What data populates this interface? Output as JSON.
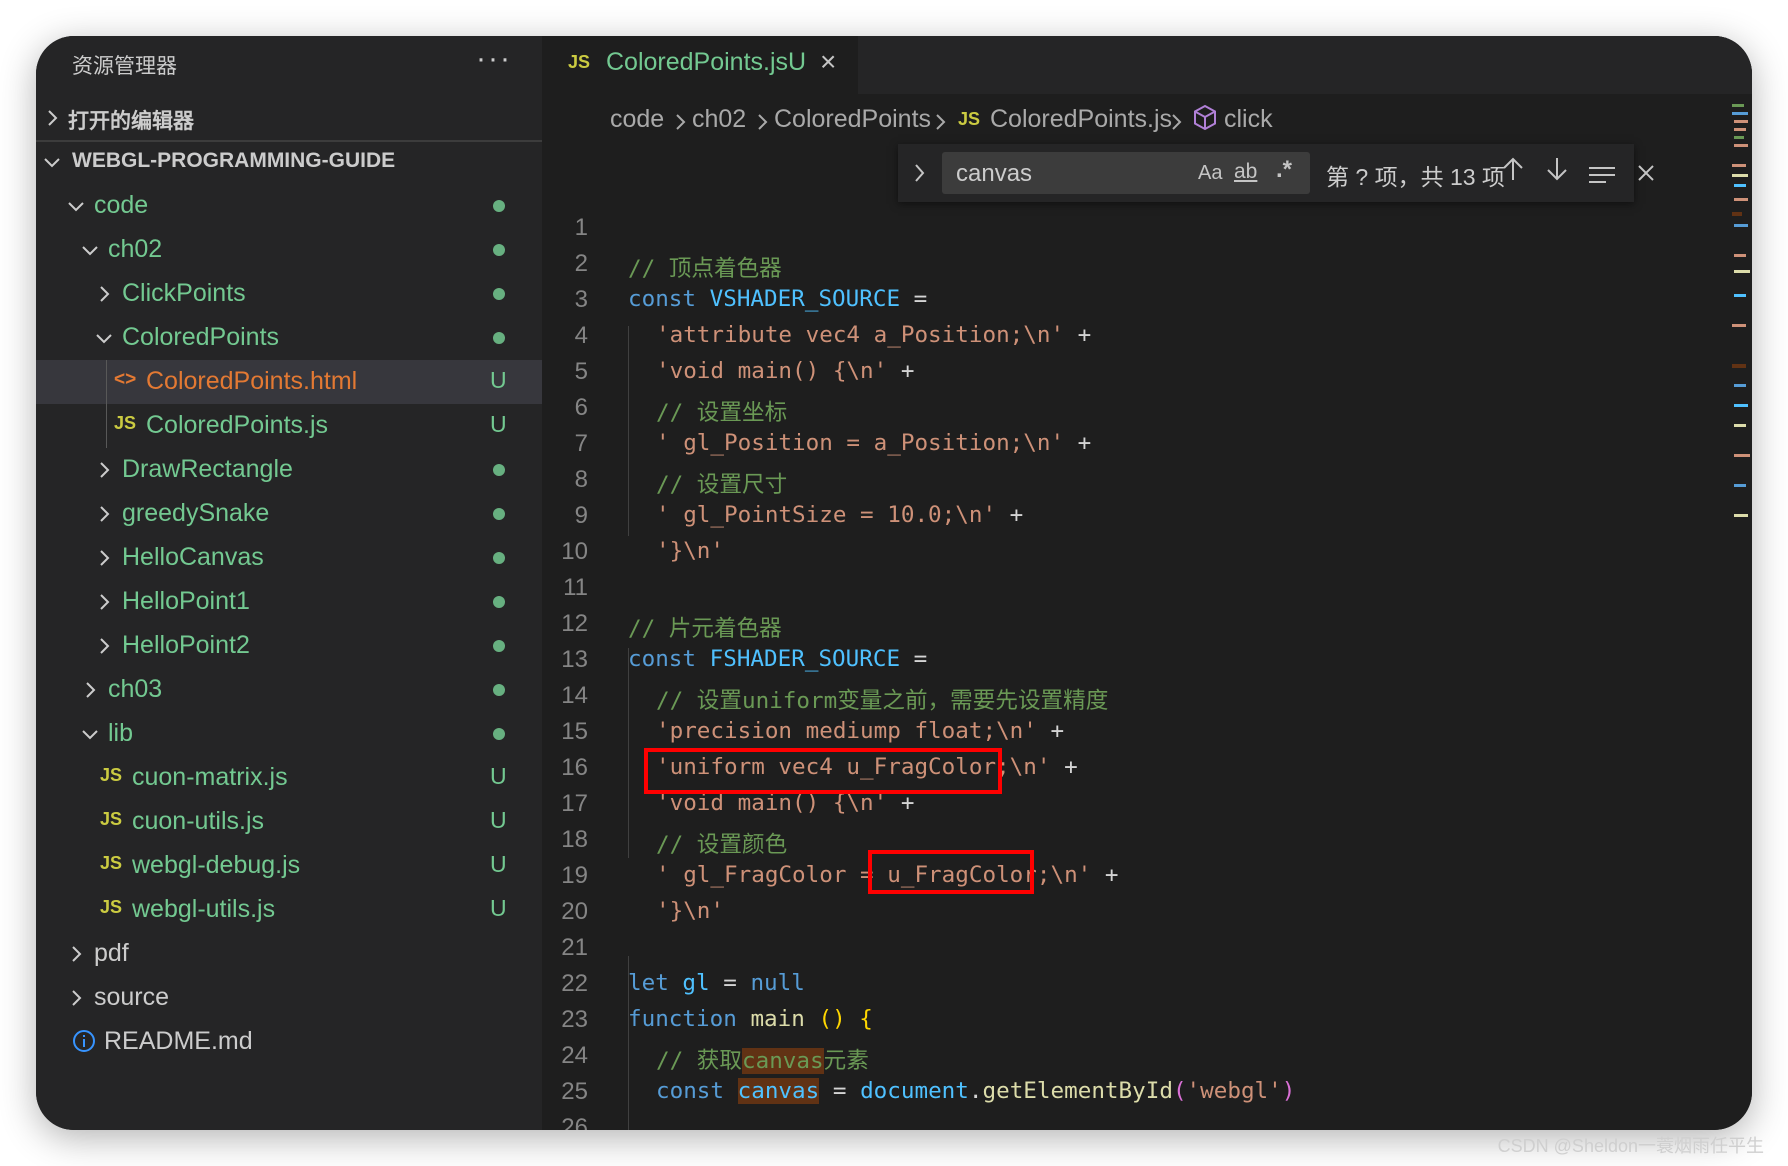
{
  "colors": {
    "folder_green": "#73c991",
    "untracked_green": "#73c991",
    "js_yellow": "#cbcb41",
    "html_orange": "#e37933",
    "info_blue": "#3794ff",
    "highlight_box": "#ff0000"
  },
  "sidebar": {
    "title": "资源管理器",
    "more_icon": "···",
    "open_editors": "打开的编辑器",
    "root": "WEBGL-PROGRAMMING-GUIDE",
    "tree": [
      {
        "label": "code",
        "depth": 0,
        "kind": "folder-open",
        "status": "dot"
      },
      {
        "label": "ch02",
        "depth": 1,
        "kind": "folder-open",
        "status": "dot"
      },
      {
        "label": "ClickPoints",
        "depth": 2,
        "kind": "folder",
        "status": "dot"
      },
      {
        "label": "ColoredPoints",
        "depth": 2,
        "kind": "folder-open",
        "status": "dot"
      },
      {
        "label": "ColoredPoints.html",
        "depth": 3,
        "kind": "html",
        "status": "U",
        "selected": true
      },
      {
        "label": "ColoredPoints.js",
        "depth": 3,
        "kind": "js",
        "status": "U"
      },
      {
        "label": "DrawRectangle",
        "depth": 2,
        "kind": "folder",
        "status": "dot"
      },
      {
        "label": "greedySnake",
        "depth": 2,
        "kind": "folder",
        "status": "dot"
      },
      {
        "label": "HelloCanvas",
        "depth": 2,
        "kind": "folder",
        "status": "dot"
      },
      {
        "label": "HelloPoint1",
        "depth": 2,
        "kind": "folder",
        "status": "dot"
      },
      {
        "label": "HelloPoint2",
        "depth": 2,
        "kind": "folder",
        "status": "dot"
      },
      {
        "label": "ch03",
        "depth": 1,
        "kind": "folder",
        "status": "dot"
      },
      {
        "label": "lib",
        "depth": 1,
        "kind": "folder-open",
        "status": "dot"
      },
      {
        "label": "cuon-matrix.js",
        "depth": 2,
        "kind": "js",
        "status": "U"
      },
      {
        "label": "cuon-utils.js",
        "depth": 2,
        "kind": "js",
        "status": "U"
      },
      {
        "label": "webgl-debug.js",
        "depth": 2,
        "kind": "js",
        "status": "U"
      },
      {
        "label": "webgl-utils.js",
        "depth": 2,
        "kind": "js",
        "status": "U"
      },
      {
        "label": "pdf",
        "depth": 0,
        "kind": "folder",
        "status": "",
        "plain": true
      },
      {
        "label": "source",
        "depth": 0,
        "kind": "folder",
        "status": "",
        "plain": true
      },
      {
        "label": "README.md",
        "depth": 0,
        "kind": "info",
        "status": "",
        "plain": true
      }
    ]
  },
  "tab": {
    "icon": "JS",
    "name": "ColoredPoints.js",
    "status": "U",
    "close": "×"
  },
  "breadcrumb": {
    "items": [
      "code",
      "ch02",
      "ColoredPoints",
      "ColoredPoints.js",
      "click"
    ],
    "js_icon": "JS"
  },
  "find": {
    "query": "canvas",
    "match_case": "Aa",
    "whole_word": "ab",
    "regex": ".*",
    "result": "第 ? 项，共 13 项"
  },
  "code_lines": [
    {
      "n": "1"
    },
    {
      "n": "2"
    },
    {
      "n": "3"
    },
    {
      "n": "4"
    },
    {
      "n": "5"
    },
    {
      "n": "6"
    },
    {
      "n": "7"
    },
    {
      "n": "8"
    },
    {
      "n": "9"
    },
    {
      "n": "10"
    },
    {
      "n": "11"
    },
    {
      "n": "12"
    },
    {
      "n": "13"
    },
    {
      "n": "14"
    },
    {
      "n": "15"
    },
    {
      "n": "16"
    },
    {
      "n": "17"
    },
    {
      "n": "18"
    },
    {
      "n": "19"
    },
    {
      "n": "20"
    },
    {
      "n": "21"
    },
    {
      "n": "22"
    },
    {
      "n": "23"
    },
    {
      "n": "24"
    },
    {
      "n": "25"
    },
    {
      "n": "26"
    }
  ],
  "code": {
    "l2": "// 顶点着色器",
    "l3_kw": "const",
    "l3_var": "VSHADER_SOURCE",
    "l3_op": " =",
    "l4_str": "'attribute vec4 a_Position;\\n'",
    "l4_op": " +",
    "l5_str": "'void main() {\\n'",
    "l5_op": " +",
    "l6": "// 设置坐标",
    "l7_str": "' gl_Position = a_Position;\\n'",
    "l7_op": " +",
    "l8": "// 设置尺寸",
    "l9_str": "' gl_PointSize = 10.0;\\n'",
    "l9_op": " +",
    "l10_str": "'}\\n'",
    "l12": "// 片元着色器",
    "l13_kw": "const",
    "l13_var": "FSHADER_SOURCE",
    "l13_op": " =",
    "l14": "// 设置uniform变量之前，需要先设置精度",
    "l15_str": "'precision mediump float;\\n'",
    "l15_op": " +",
    "l16_str": "'uniform vec4 u_FragColor;\\n'",
    "l16_op": " +",
    "l17_str": "'void main() {\\n'",
    "l17_op": " +",
    "l18": "// 设置颜色",
    "l19_str": "' gl_FragColor = u_FragColor;\\n'",
    "l19_op": " +",
    "l20_str": "'}\\n'",
    "l22_kw": "let",
    "l22_var": "gl",
    "l22_op": " = ",
    "l22_null": "null",
    "l23_kw": "function",
    "l23_fn": "main",
    "l23_paren": "()",
    "l23_brace": "{",
    "l24_a": "// 获取",
    "l24_b": "canvas",
    "l24_c": "元素",
    "l25_kw": "const",
    "l25_var": "canvas",
    "l25_op": " = ",
    "l25_obj": "document",
    "l25_dot": ".",
    "l25_fn": "getElementById",
    "l25_p1": "(",
    "l25_str": "'webgl'",
    "l25_p2": ")"
  },
  "watermark": "CSDN @Sheldon一蓑烟雨任平生"
}
